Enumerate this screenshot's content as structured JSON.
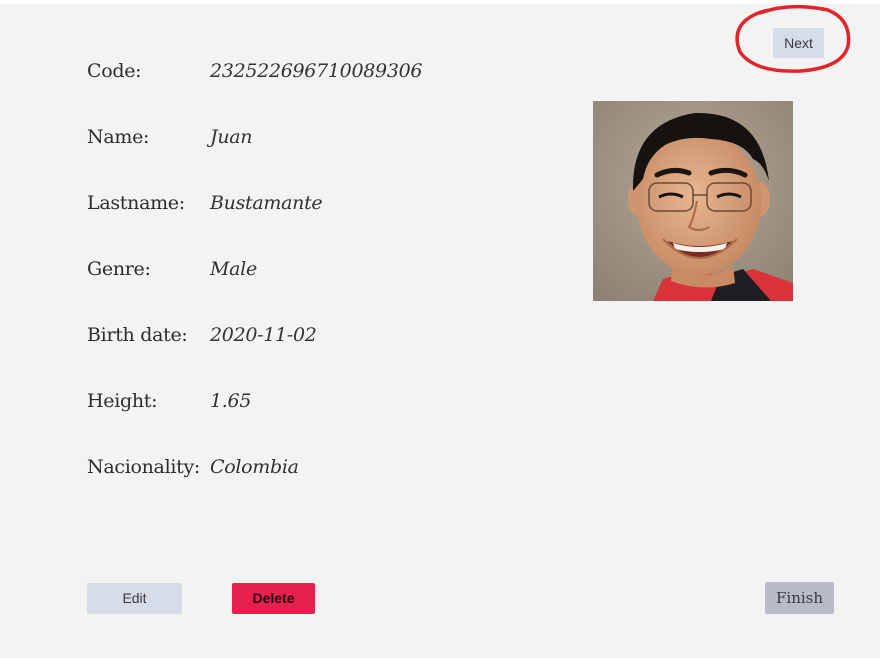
{
  "fields": [
    {
      "label": "Code:",
      "value": "232522696710089306"
    },
    {
      "label": "Name:",
      "value": "Juan"
    },
    {
      "label": "Lastname:",
      "value": "Bustamante"
    },
    {
      "label": "Genre:",
      "value": "Male"
    },
    {
      "label": "Birth date:",
      "value": "2020-11-02"
    },
    {
      "label": "Height:",
      "value": "1.65"
    },
    {
      "label": "Nacionality:",
      "value": "Colombia"
    }
  ],
  "buttons": {
    "next": "Next",
    "edit": "Edit",
    "delete": "Delete",
    "finish": "Finish"
  },
  "colors": {
    "background": "#f3f3f4",
    "primary_button": "#d6dce8",
    "delete_button": "#e8204f",
    "finish_button": "#b7bcc6",
    "annotation_circle": "#e0262b"
  }
}
